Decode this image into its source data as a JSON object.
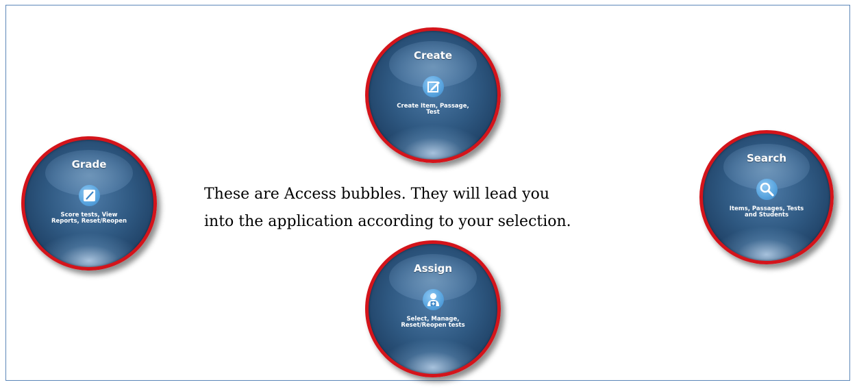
{
  "caption": {
    "line1": "These are Access bubbles. They will lead you",
    "line2": "into the application according to your selection."
  },
  "bubbles": {
    "create": {
      "title": "Create",
      "subtitle": "Create Item, Passage,\nTest",
      "icon": "edit-square-icon"
    },
    "grade": {
      "title": "Grade",
      "subtitle": "Score tests, View\nReports, Reset/Reopen",
      "icon": "pencil-icon"
    },
    "search": {
      "title": "Search",
      "subtitle": "Items, Passages, Tests\nand Students",
      "icon": "magnifier-icon"
    },
    "assign": {
      "title": "Assign",
      "subtitle": "Select, Manage,\nReset/Reopen tests",
      "icon": "user-add-icon"
    }
  },
  "colors": {
    "ring": "#d4141b",
    "bubble": "#2f5982",
    "icon": "#5ba6e0",
    "frame": "#5b86b8"
  }
}
